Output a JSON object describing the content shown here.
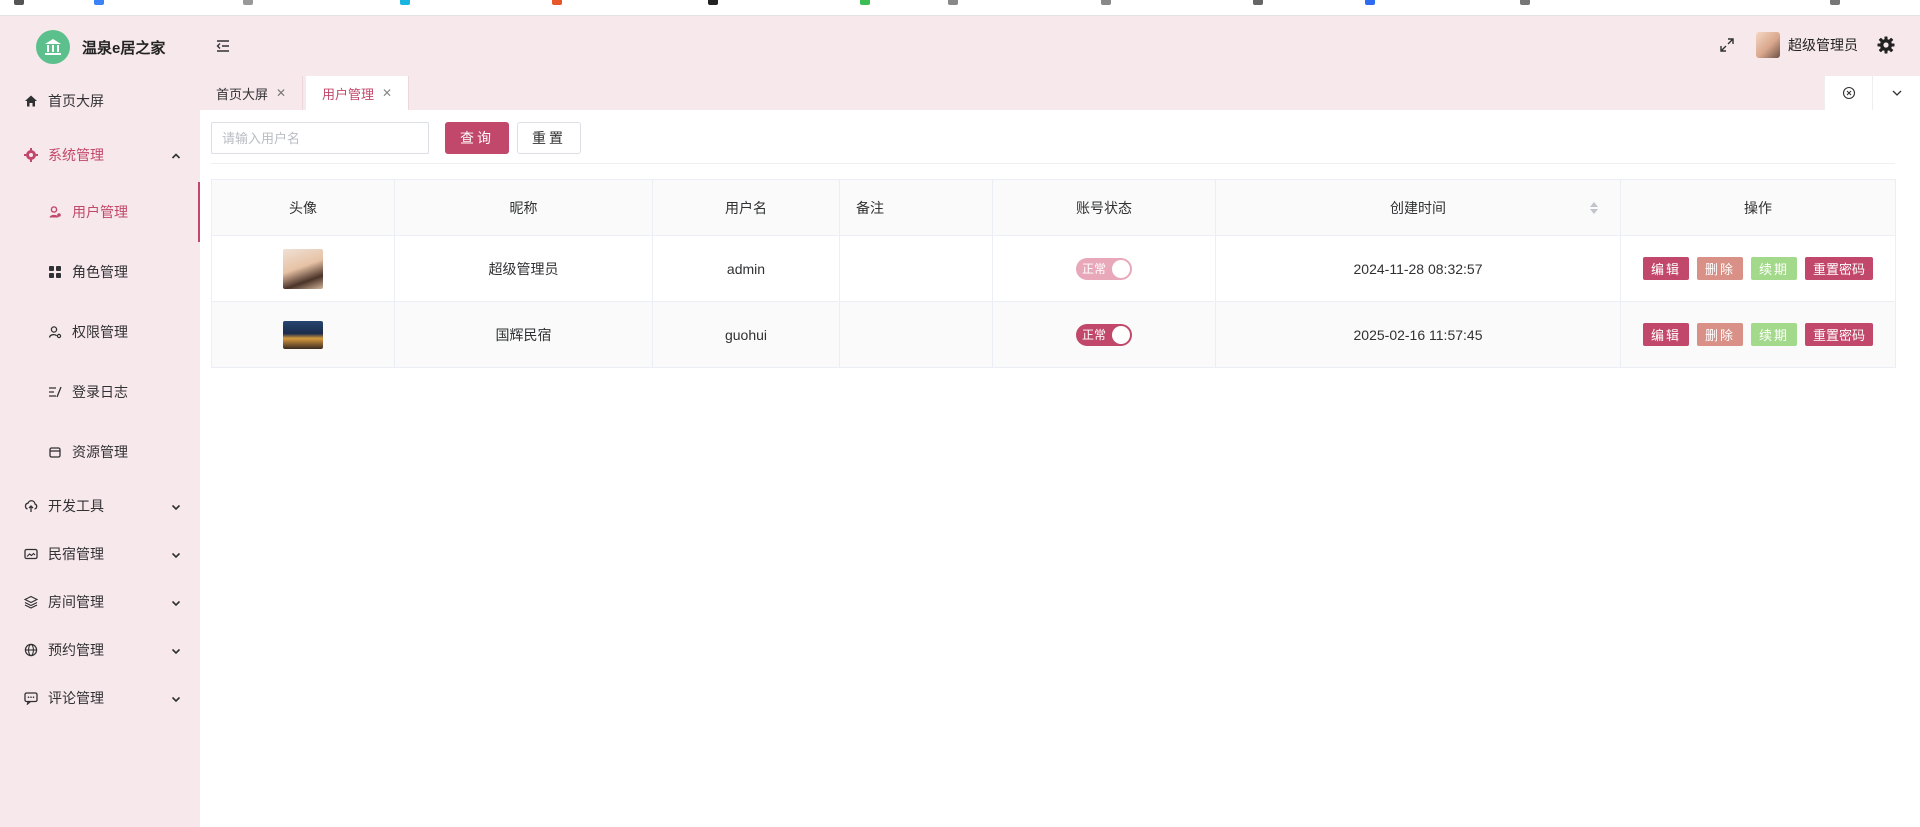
{
  "app": {
    "title": "温泉e居之家",
    "colors": {
      "accent": "#c1486a",
      "sidebar_bg": "#f7e8ec",
      "logo_bg": "#5cc08c",
      "delete": "#d99087",
      "renew": "#a3d98a"
    }
  },
  "sidebar": {
    "items": [
      {
        "label": "首页大屏",
        "icon": "home-icon"
      },
      {
        "label": "系统管理",
        "icon": "gear-icon",
        "expanded": true
      },
      {
        "label": "用户管理",
        "icon": "user-icon",
        "active": true
      },
      {
        "label": "角色管理",
        "icon": "grid-icon"
      },
      {
        "label": "权限管理",
        "icon": "user-key-icon"
      },
      {
        "label": "登录日志",
        "icon": "log-icon"
      },
      {
        "label": "资源管理",
        "icon": "box-icon"
      },
      {
        "label": "开发工具",
        "icon": "cloud-upload-icon"
      },
      {
        "label": "民宿管理",
        "icon": "image-icon"
      },
      {
        "label": "房间管理",
        "icon": "layers-icon"
      },
      {
        "label": "预约管理",
        "icon": "globe-icon"
      },
      {
        "label": "评论管理",
        "icon": "chat-icon"
      }
    ]
  },
  "header": {
    "user_name": "超级管理员",
    "icons": [
      "menu-fold-icon",
      "fullscreen-icon",
      "settings-icon"
    ]
  },
  "tabs": [
    {
      "label": "首页大屏",
      "active": false
    },
    {
      "label": "用户管理",
      "active": true
    }
  ],
  "search": {
    "placeholder": "请输入用户名",
    "value": "",
    "query_label": "查询",
    "reset_label": "重置"
  },
  "table": {
    "columns": [
      "头像",
      "昵称",
      "用户名",
      "备注",
      "账号状态",
      "创建时间",
      "操作"
    ],
    "rows": [
      {
        "nickname": "超级管理员",
        "username": "admin",
        "remark": "",
        "status": "正常",
        "status_on": true,
        "status_disabled": true,
        "created": "2024-11-28 08:32:57"
      },
      {
        "nickname": "国辉民宿",
        "username": "guohui",
        "remark": "",
        "status": "正常",
        "status_on": true,
        "status_disabled": false,
        "created": "2025-02-16 11:57:45"
      }
    ],
    "actions": {
      "edit": "编辑",
      "delete": "删除",
      "renew": "续期",
      "reset_password": "重置密码"
    }
  }
}
